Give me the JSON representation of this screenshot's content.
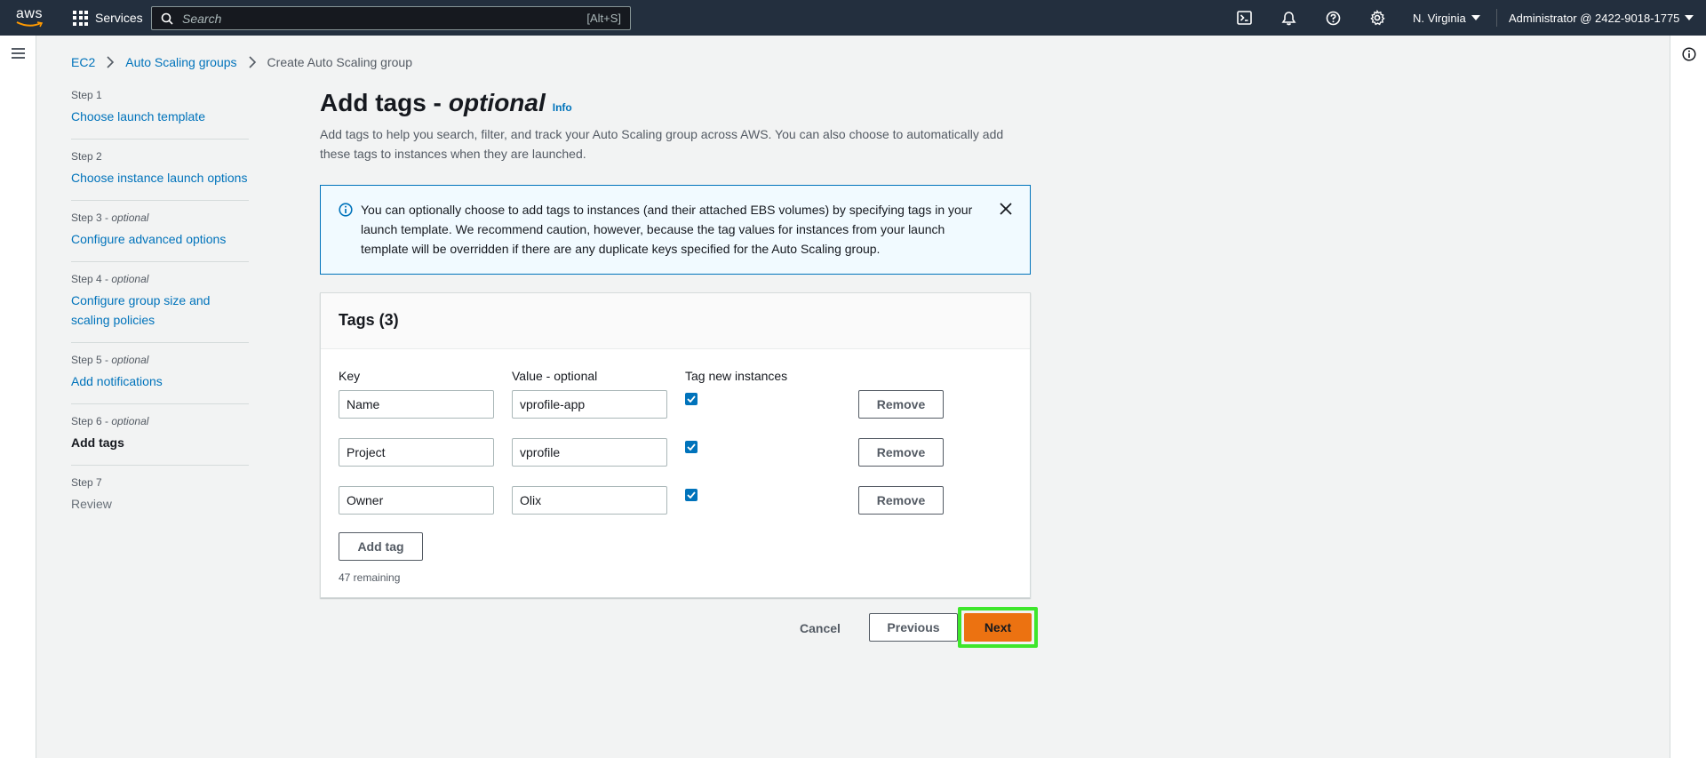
{
  "topnav": {
    "logo_text": "aws",
    "services_label": "Services",
    "search_placeholder": "Search",
    "search_shortcut": "[Alt+S]",
    "region": "N. Virginia",
    "account": "Administrator @ 2422-9018-1775",
    "icons": [
      "cloudshell-icon",
      "bell-icon",
      "help-icon",
      "settings-icon"
    ]
  },
  "breadcrumb": [
    {
      "label": "EC2"
    },
    {
      "label": "Auto Scaling groups"
    },
    {
      "label": "Create Auto Scaling group"
    }
  ],
  "steps": [
    {
      "num": "Step 1",
      "opt": "",
      "title": "Choose launch template",
      "state": "link"
    },
    {
      "num": "Step 2",
      "opt": "",
      "title": "Choose instance launch options",
      "state": "link"
    },
    {
      "num": "Step 3",
      "opt": "optional",
      "title": "Configure advanced options",
      "state": "link"
    },
    {
      "num": "Step 4",
      "opt": "optional",
      "title": "Configure group size and scaling policies",
      "state": "link"
    },
    {
      "num": "Step 5",
      "opt": "optional",
      "title": "Add notifications",
      "state": "link"
    },
    {
      "num": "Step 6",
      "opt": "optional",
      "title": "Add tags",
      "state": "active"
    },
    {
      "num": "Step 7",
      "opt": "",
      "title": "Review",
      "state": "disabled"
    }
  ],
  "main": {
    "title": "Add tags -",
    "title_optional": "optional",
    "info_label": "Info",
    "description": "Add tags to help you search, filter, and track your Auto Scaling group across AWS. You can also choose to automatically add these tags to instances when they are launched.",
    "alert_text": "You can optionally choose to add tags to instances (and their attached EBS volumes) by specifying tags in your launch template. We recommend caution, however, because the tag values for instances from your launch template will be overridden if there are any duplicate keys specified for the Auto Scaling group.",
    "panel_title": "Tags (3)",
    "col_key": "Key",
    "col_value": "Value - optional",
    "col_tag_new": "Tag new instances",
    "tags": [
      {
        "key": "Name",
        "value": "vprofile-app",
        "tag_new": true,
        "remove_label": "Remove"
      },
      {
        "key": "Project",
        "value": "vprofile",
        "tag_new": true,
        "remove_label": "Remove"
      },
      {
        "key": "Owner",
        "value": "Olix",
        "tag_new": true,
        "remove_label": "Remove"
      }
    ],
    "add_tag_label": "Add tag",
    "remaining": "47 remaining"
  },
  "actions": {
    "cancel": "Cancel",
    "previous": "Previous",
    "next": "Next"
  },
  "colors": {
    "nav_bg": "#232f3e",
    "link": "#0073bb",
    "primary": "#ec7211",
    "highlight": "#3ee62b"
  }
}
